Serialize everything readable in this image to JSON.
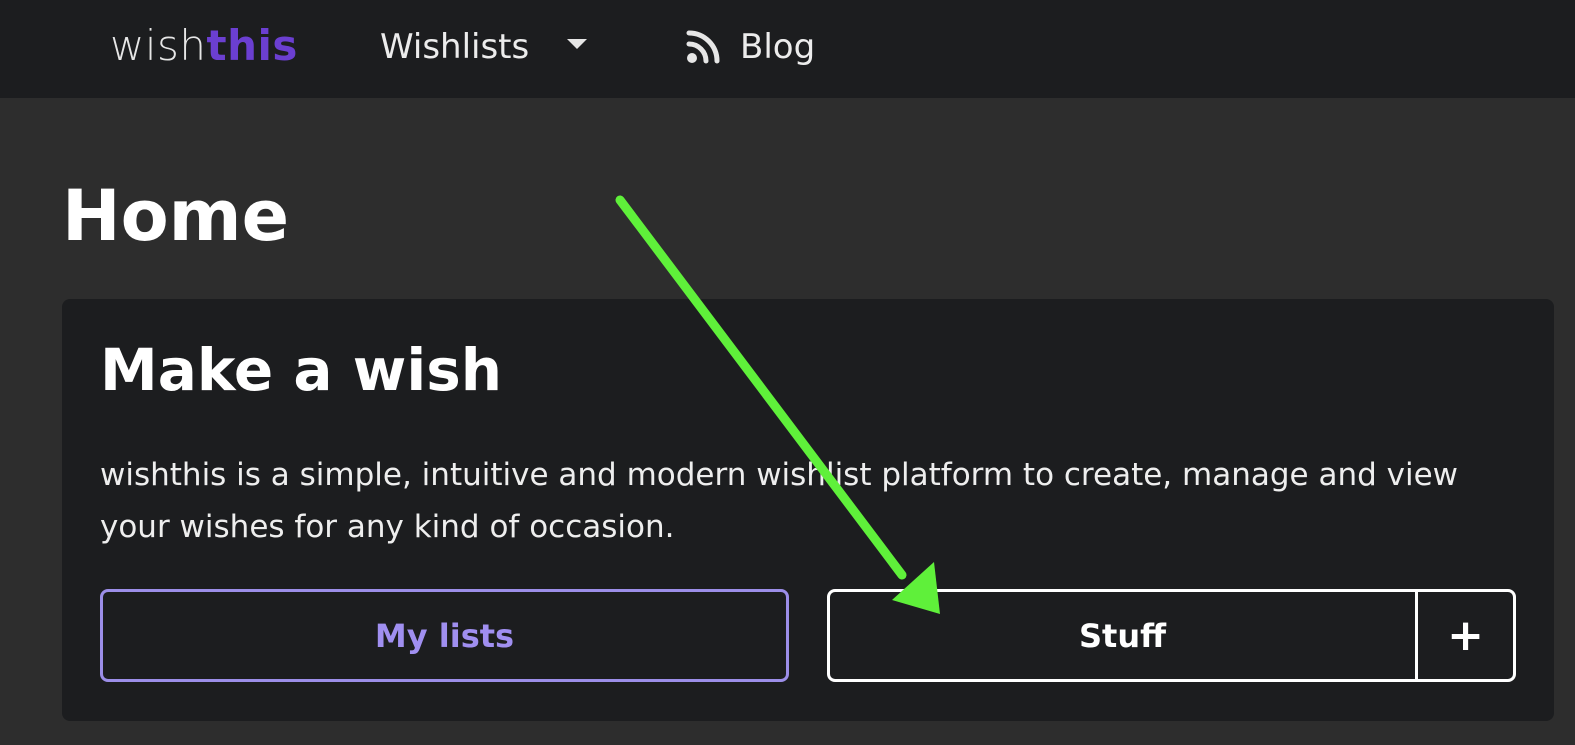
{
  "header": {
    "logo_part1": "wish",
    "logo_part2": "this",
    "nav": [
      {
        "label": "Wishlists",
        "icon": "chevron-down-icon"
      },
      {
        "label": "Blog",
        "icon": "rss-icon"
      }
    ]
  },
  "main": {
    "page_title": "Home",
    "card": {
      "title": "Make a wish",
      "description": "wishthis is a simple, intuitive and modern wishlist platform to create, manage and view your wishes for any kind of occasion.",
      "my_lists_label": "My lists",
      "wishlist_label": "Stuff",
      "add_label": "+"
    }
  },
  "colors": {
    "accent": "#6b3fd1",
    "button_accent": "#9c8ee8",
    "annotation_arrow": "#5ff03a"
  }
}
